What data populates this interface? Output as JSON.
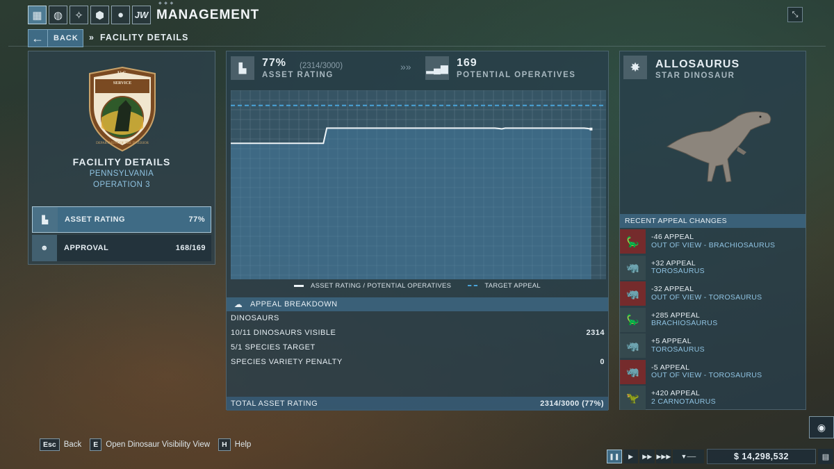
{
  "header": {
    "title": "MANAGEMENT",
    "back_label": "BACK",
    "breadcrumb_sep": "»",
    "breadcrumb": "FACILITY DETAILS",
    "nav_icons": [
      "management-icon",
      "globe-icon",
      "dna-icon",
      "hex-icon",
      "person-icon",
      "jw-icon"
    ],
    "jw_label": "JW"
  },
  "facility": {
    "title": "FACILITY DETAILS",
    "location": "PENNSYLVANIA",
    "operation": "OPERATION 3",
    "emblem_top": "U.S.",
    "emblem_mid": "FISH & WILDLIFE SERVICE",
    "emblem_ring": "DEPARTMENT OF THE INTERIOR",
    "stats": [
      {
        "label": "ASSET RATING",
        "value": "77%",
        "icon": "rating-icon"
      },
      {
        "label": "APPROVAL",
        "value": "168/169",
        "icon": "people-icon"
      }
    ]
  },
  "kpi": {
    "rating_pct": "77%",
    "rating_detail": "(2314/3000)",
    "rating_label": "ASSET RATING",
    "operatives": "169",
    "operatives_label": "POTENTIAL OPERATIVES",
    "arrows": "»»"
  },
  "chart_data": {
    "type": "line",
    "series": [
      {
        "name": "ASSET RATING / POTENTIAL OPERATIVES",
        "values": [
          0.72,
          0.72,
          0.72,
          0.72,
          0.72,
          0.72,
          0.72,
          0.72,
          0.72,
          0.72,
          0.72,
          0.72,
          0.72,
          0.72,
          0.72,
          0.72,
          0.72,
          0.72,
          0.72,
          0.72,
          0.72,
          0.72,
          0.72,
          0.72,
          0.72,
          0.72,
          0.72,
          0.72,
          0.8,
          0.8,
          0.8,
          0.8,
          0.8,
          0.8,
          0.8,
          0.8,
          0.8,
          0.8,
          0.8,
          0.8,
          0.8,
          0.8,
          0.8,
          0.8,
          0.8,
          0.8,
          0.8,
          0.8,
          0.8,
          0.8,
          0.8,
          0.8,
          0.8,
          0.8,
          0.8,
          0.8,
          0.8,
          0.8,
          0.8,
          0.8,
          0.8,
          0.8,
          0.8,
          0.8,
          0.8,
          0.8,
          0.8,
          0.8,
          0.8,
          0.8,
          0.8,
          0.8,
          0.8,
          0.8,
          0.8,
          0.8,
          0.8,
          0.8,
          0.798,
          0.796,
          0.8,
          0.8,
          0.8,
          0.8,
          0.8,
          0.8,
          0.8,
          0.8,
          0.8,
          0.8,
          0.8,
          0.8,
          0.8,
          0.8,
          0.8,
          0.8,
          0.8,
          0.8,
          0.8,
          0.8,
          0.8,
          0.8,
          0.8,
          0.8,
          0.798,
          0.795
        ]
      },
      {
        "name": "TARGET APPEAL",
        "values": [
          0.92
        ],
        "style": "dashed"
      }
    ],
    "ylim": [
      0,
      1
    ],
    "grid": true,
    "line_color": "#eef4f7",
    "target_color": "#4aa3d8"
  },
  "legend": {
    "series1": "ASSET RATING / POTENTIAL OPERATIVES",
    "series2": "TARGET APPEAL"
  },
  "breakdown": {
    "title": "APPEAL BREAKDOWN",
    "section": "DINOSAURS",
    "rows": [
      {
        "label": "10/11 DINOSAURS VISIBLE",
        "value": "2314"
      },
      {
        "label": "5/1 SPECIES TARGET",
        "value": ""
      },
      {
        "label": "SPECIES VARIETY PENALTY",
        "value": "0"
      }
    ],
    "total_label": "TOTAL ASSET RATING",
    "total_value": "2314/3000 (77%)"
  },
  "star": {
    "name": "ALLOSAURUS",
    "subtitle": "STAR DINOSAUR"
  },
  "recent": {
    "title": "RECENT APPEAL CHANGES",
    "items": [
      {
        "line1": "-46 APPEAL",
        "line2": "OUT OF VIEW - BRACHIOSAURUS",
        "type": "neg",
        "icon": "brachiosaurus-icon"
      },
      {
        "line1": "+32 APPEAL",
        "line2": "TOROSAURUS",
        "type": "pos",
        "icon": "torosaurus-icon"
      },
      {
        "line1": "-32 APPEAL",
        "line2": "OUT OF VIEW - TOROSAURUS",
        "type": "neg",
        "icon": "torosaurus-icon"
      },
      {
        "line1": "+285 APPEAL",
        "line2": "BRACHIOSAURUS",
        "type": "pos",
        "icon": "brachiosaurus-icon"
      },
      {
        "line1": "+5 APPEAL",
        "line2": "TOROSAURUS",
        "type": "pos",
        "icon": "torosaurus-icon"
      },
      {
        "line1": "-5 APPEAL",
        "line2": "OUT OF VIEW - TOROSAURUS",
        "type": "neg",
        "icon": "torosaurus-icon"
      },
      {
        "line1": "+420 APPEAL",
        "line2": "2 CARNOTAURUS",
        "type": "pos",
        "icon": "carnotaurus-icon"
      }
    ]
  },
  "footer": {
    "hints": [
      {
        "key": "Esc",
        "label": "Back"
      },
      {
        "key": "E",
        "label": "Open Dinosaur Visibility View"
      },
      {
        "key": "H",
        "label": "Help"
      }
    ],
    "money": "$ 14,298,532"
  }
}
